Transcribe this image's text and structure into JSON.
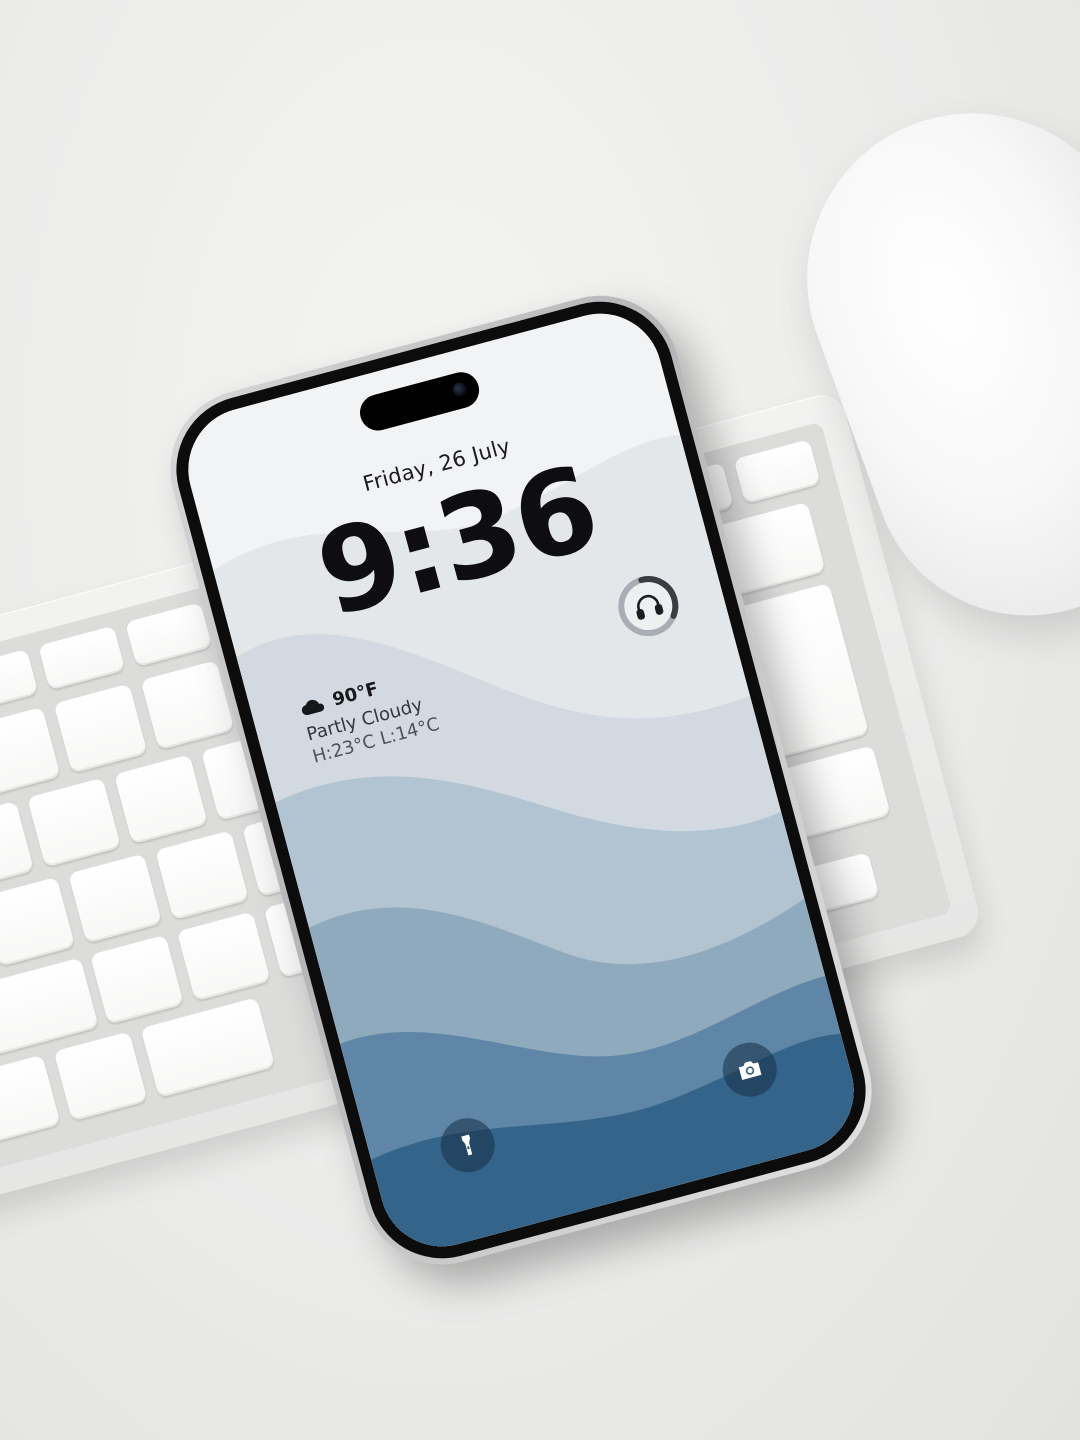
{
  "lock_screen": {
    "date": "Friday, 26 July",
    "time": "9:36"
  },
  "now_playing_widget": {
    "icon": "headphones-icon",
    "progress": 0.35
  },
  "weather": {
    "icon": "cloud-icon",
    "temperature": "90°F",
    "condition": "Partly Cloudy",
    "range": "H:23°C L:14°C"
  },
  "quick_actions": {
    "left_icon": "flashlight-icon",
    "right_icon": "camera-icon"
  },
  "colors": {
    "wallpaper_top": "#f1f2f3",
    "wallpaper_bottom": "#2f6287",
    "clock": "#0e0e10"
  }
}
